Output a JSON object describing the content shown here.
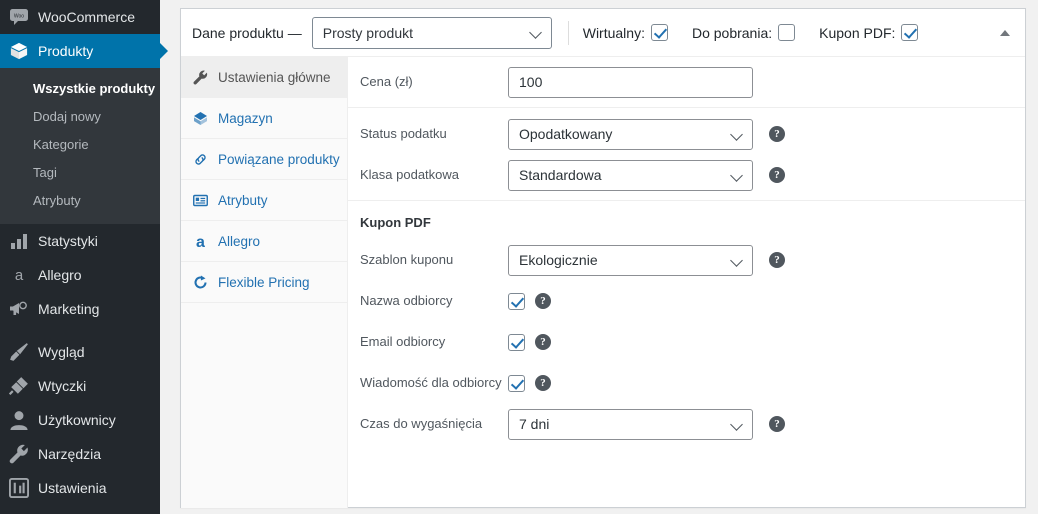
{
  "sidebar": {
    "items": [
      {
        "label": "WooCommerce",
        "icon": "woo-logo-icon",
        "current": false
      },
      {
        "label": "Produkty",
        "icon": "products-box-icon",
        "current": true
      },
      {
        "label": "Statystyki",
        "icon": "bar-chart-icon",
        "current": false
      },
      {
        "label": "Allegro",
        "icon": "allegro-a-icon",
        "current": false
      },
      {
        "label": "Marketing",
        "icon": "megaphone-icon",
        "current": false
      },
      {
        "label": "Wygląd",
        "icon": "paintbrush-icon",
        "current": false
      },
      {
        "label": "Wtyczki",
        "icon": "plug-icon",
        "current": false
      },
      {
        "label": "Użytkownicy",
        "icon": "user-icon",
        "current": false
      },
      {
        "label": "Narzędzia",
        "icon": "wrench-icon",
        "current": false
      },
      {
        "label": "Ustawienia",
        "icon": "settings-sliders-icon",
        "current": false
      }
    ],
    "submenu": [
      {
        "label": "Wszystkie produkty",
        "active": true
      },
      {
        "label": "Dodaj nowy",
        "active": false
      },
      {
        "label": "Kategorie",
        "active": false
      },
      {
        "label": "Tagi",
        "active": false
      },
      {
        "label": "Atrybuty",
        "active": false
      }
    ]
  },
  "panel": {
    "header": {
      "title": "Dane produktu —",
      "product_type": "Prosty produkt",
      "checkboxes": [
        {
          "label": "Wirtualny:",
          "checked": true
        },
        {
          "label": "Do pobrania:",
          "checked": false
        },
        {
          "label": "Kupon PDF:",
          "checked": true
        }
      ]
    },
    "tabs": [
      {
        "label": "Ustawienia główne",
        "icon": "wrench-icon",
        "active": true
      },
      {
        "label": "Magazyn",
        "icon": "inventory-box-icon",
        "active": false
      },
      {
        "label": "Powiązane produkty",
        "icon": "link-icon",
        "active": false
      },
      {
        "label": "Atrybuty",
        "icon": "attributes-list-icon",
        "active": false
      },
      {
        "label": "Allegro",
        "icon": "allegro-a-icon",
        "active": false
      },
      {
        "label": "Flexible Pricing",
        "icon": "refresh-circle-icon",
        "active": false
      }
    ],
    "fields": {
      "price_label": "Cena (zł)",
      "price_value": "100",
      "tax_status_label": "Status podatku",
      "tax_status_value": "Opodatkowany",
      "tax_class_label": "Klasa podatkowa",
      "tax_class_value": "Standardowa",
      "section_title": "Kupon PDF",
      "coupon_template_label": "Szablon kuponu",
      "coupon_template_value": "Ekologicznie",
      "recipient_name_label": "Nazwa odbiorcy",
      "recipient_name_checked": true,
      "recipient_email_label": "Email odbiorcy",
      "recipient_email_checked": true,
      "recipient_message_label": "Wiadomość dla odbiorcy",
      "recipient_message_checked": true,
      "expiry_label": "Czas do wygaśnięcia",
      "expiry_value": "7 dni",
      "help_glyph": "?"
    }
  },
  "colors": {
    "sidebar_bg": "#23282d",
    "submenu_bg": "#32373c",
    "accent_blue": "#0073aa",
    "link_blue": "#2271b1",
    "page_bg": "#f1f1f1"
  }
}
